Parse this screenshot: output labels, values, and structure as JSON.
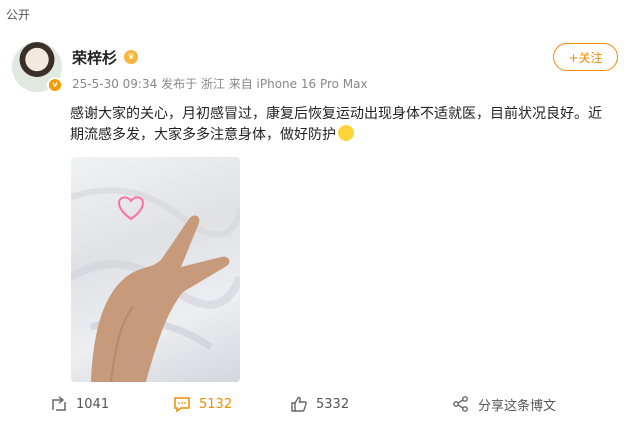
{
  "visibility": "公开",
  "user": {
    "name": "荣梓杉"
  },
  "post": {
    "date": "25-5-30 09:34",
    "published_from": "发布于 浙江",
    "device": "来自 iPhone 16 Pro Max",
    "text": "感谢大家的关心，月初感冒过，康复后恢复运动出现身体不适就医，目前状况良好。近期流感多发，大家多多注意身体，做好防护"
  },
  "follow_label": "+关注",
  "actions": {
    "repost_count": "1041",
    "comment_count": "5132",
    "like_count": "5332",
    "share_label": "分享这条博文"
  },
  "colors": {
    "accent": "#f28b00",
    "text": "#222222",
    "meta": "#888888"
  },
  "icons": [
    "repost-icon",
    "comment-icon",
    "like-icon",
    "share-icon",
    "crown-icon",
    "verified-icon"
  ]
}
